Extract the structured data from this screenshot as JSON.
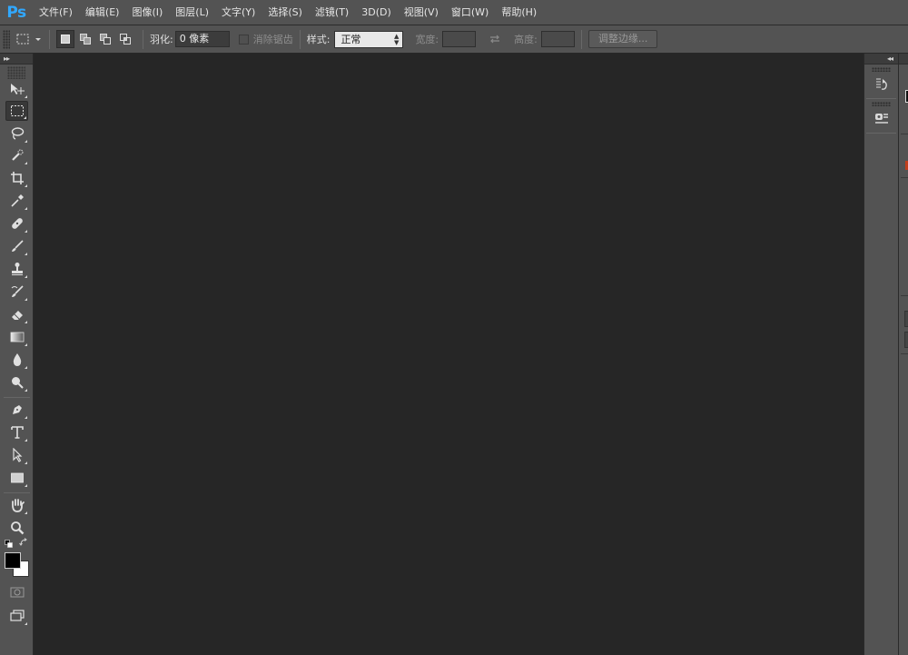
{
  "app": {
    "logo": "Ps",
    "accent_color": "#31a8ff"
  },
  "menu": {
    "items": [
      "文件(F)",
      "编辑(E)",
      "图像(I)",
      "图层(L)",
      "文字(Y)",
      "选择(S)",
      "滤镜(T)",
      "3D(D)",
      "视图(V)",
      "窗口(W)",
      "帮助(H)"
    ]
  },
  "options": {
    "tool_preset_icon": "rect-marquee-icon",
    "selection_modes": [
      "new-selection-icon",
      "add-to-selection-icon",
      "subtract-from-selection-icon",
      "intersect-selection-icon"
    ],
    "active_mode": "new-selection-icon",
    "feather_label": "羽化:",
    "feather_value": "0 像素",
    "antialias_label": "消除锯齿",
    "style_label": "样式:",
    "style_value": "正常",
    "width_label": "宽度:",
    "width_value": "",
    "swap_icon": "swap-icon",
    "height_label": "高度:",
    "height_value": "",
    "refine_edge_label": "调整边缘..."
  },
  "toolbar": {
    "collapse_icon": "double-chevron-right-icon",
    "tools": [
      "move-tool-icon",
      "rect-marquee-icon",
      "lasso-icon",
      "quick-select-icon",
      "crop-icon",
      "eyedropper-icon",
      "healing-brush-icon",
      "brush-icon",
      "clone-stamp-icon",
      "history-brush-icon",
      "eraser-icon",
      "gradient-icon",
      "blur-icon",
      "dodge-icon",
      "pen-icon",
      "type-icon",
      "path-select-icon",
      "rectangle-shape-icon",
      "hand-icon",
      "zoom-icon"
    ],
    "active_tool": "rect-marquee-icon",
    "foreground_color": "#000000",
    "background_color": "#ffffff"
  },
  "dock": {
    "collapse_icon": "double-chevron-left-icon",
    "icons": [
      "history-panel-icon",
      "properties-panel-icon"
    ]
  }
}
